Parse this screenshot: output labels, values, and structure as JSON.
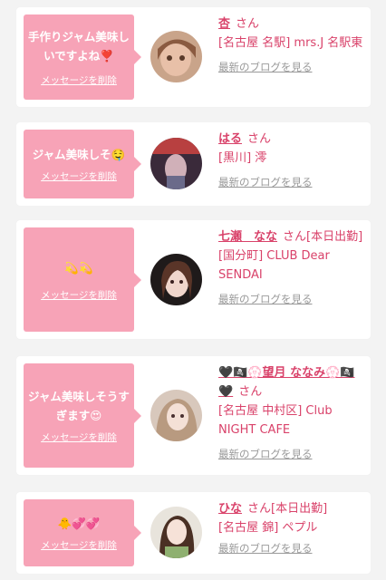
{
  "cards": [
    {
      "message": "手作りジャム美味しいですよね❣️",
      "delete_label": "メッセージを削除",
      "name": "杏",
      "san": "さん",
      "shop": "[名古屋 名駅] mrs.J 名駅東",
      "blog_label": "最新のブログを見る"
    },
    {
      "message": "ジャム美味しそ🤤",
      "delete_label": "メッセージを削除",
      "name": "はる",
      "san": "さん",
      "shop": "[黒川] 澪",
      "blog_label": "最新のブログを見る"
    },
    {
      "message": "💫💫",
      "delete_label": "メッセージを削除",
      "name": "七瀬　なな",
      "san": "さん[本日出勤]",
      "shop": "[国分町] CLUB Dear SENDAI",
      "blog_label": "最新のブログを見る"
    },
    {
      "message": "ジャム美味しそうすぎます😍",
      "delete_label": "メッセージを削除",
      "name": "🖤🏴‍☠️💮望月 ななみ💮🏴‍☠️🖤",
      "san": "さん",
      "shop": "[名古屋 中村区] Club NIGHT CAFE",
      "blog_label": "最新のブログを見る"
    },
    {
      "message": "🐥💞💞",
      "delete_label": "メッセージを削除",
      "name": "ひな",
      "san": "さん[本日出勤]",
      "shop": "[名古屋 錦] ペプル",
      "blog_label": "最新のブログを見る"
    }
  ],
  "colors": {
    "bubble": "#f7a3b7",
    "accent": "#d9426a",
    "muted": "#999999",
    "background": "#f3f3f3"
  }
}
